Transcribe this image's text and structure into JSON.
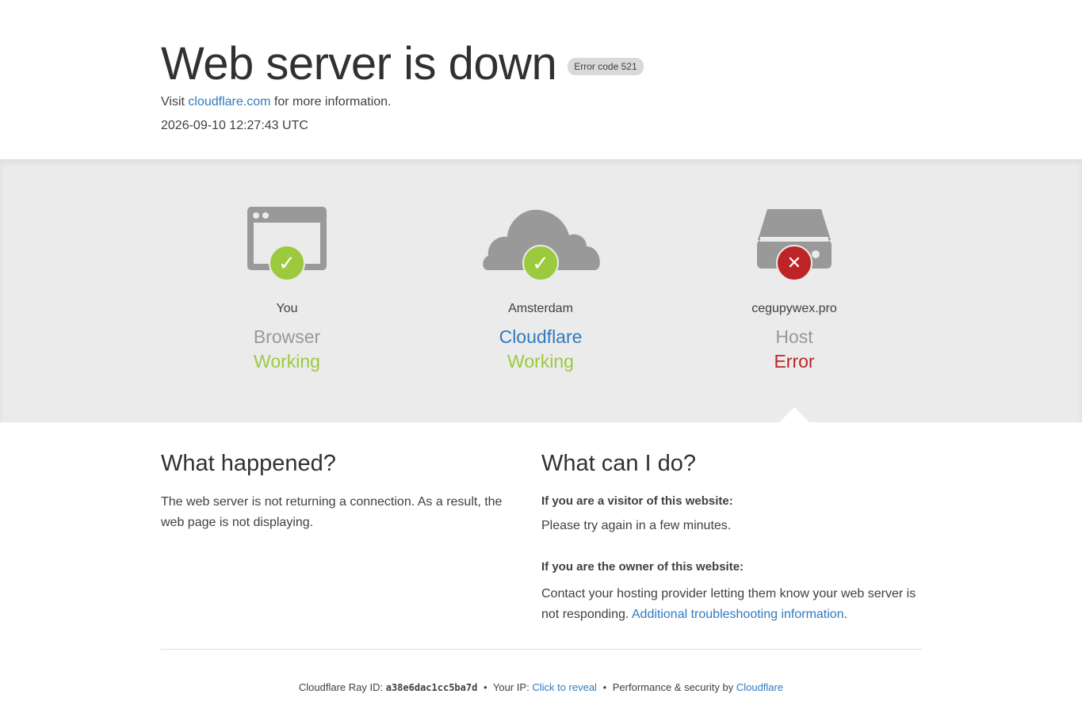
{
  "header": {
    "title": "Web server is down",
    "error_badge": "Error code 521",
    "visit_prefix": "Visit",
    "visit_link": "cloudflare.com",
    "visit_suffix": "for more information.",
    "timestamp": "2026-09-10 12:27:43 UTC"
  },
  "status": {
    "browser": {
      "location": "You",
      "kind": "Browser",
      "state": "Working",
      "icon": "browser-icon",
      "badge": "check"
    },
    "cloudflare": {
      "location": "Amsterdam",
      "kind": "Cloudflare",
      "state": "Working",
      "icon": "cloud-icon",
      "badge": "check"
    },
    "host": {
      "location": "cegupywex.pro",
      "kind": "Host",
      "state": "Error",
      "icon": "server-icon",
      "badge": "cross"
    }
  },
  "what_happened": {
    "heading": "What happened?",
    "body": "The web server is not returning a connection. As a result, the web page is not displaying."
  },
  "what_can_i_do": {
    "heading": "What can I do?",
    "visitor_q": "If you are a visitor of this website:",
    "visitor_a": "Please try again in a few minutes.",
    "owner_q": "If you are the owner of this website:",
    "owner_a": "Contact your hosting provider letting them know your web server is not responding.",
    "owner_link": "Additional troubleshooting information",
    "owner_end": "."
  },
  "footer": {
    "ray_label": "Cloudflare Ray ID:",
    "ray_id": "a38e6dac1cc5ba7d",
    "bullet": "•",
    "ip_label": "Your IP:",
    "ip_link": "Click to reveal",
    "perf_label": "Performance & security by",
    "perf_link": "Cloudflare"
  },
  "colors": {
    "ok": "#9bca3e",
    "error": "#bd2426",
    "link": "#2f7bbf",
    "icon_gray": "#999999",
    "band": "#ebebeb"
  }
}
